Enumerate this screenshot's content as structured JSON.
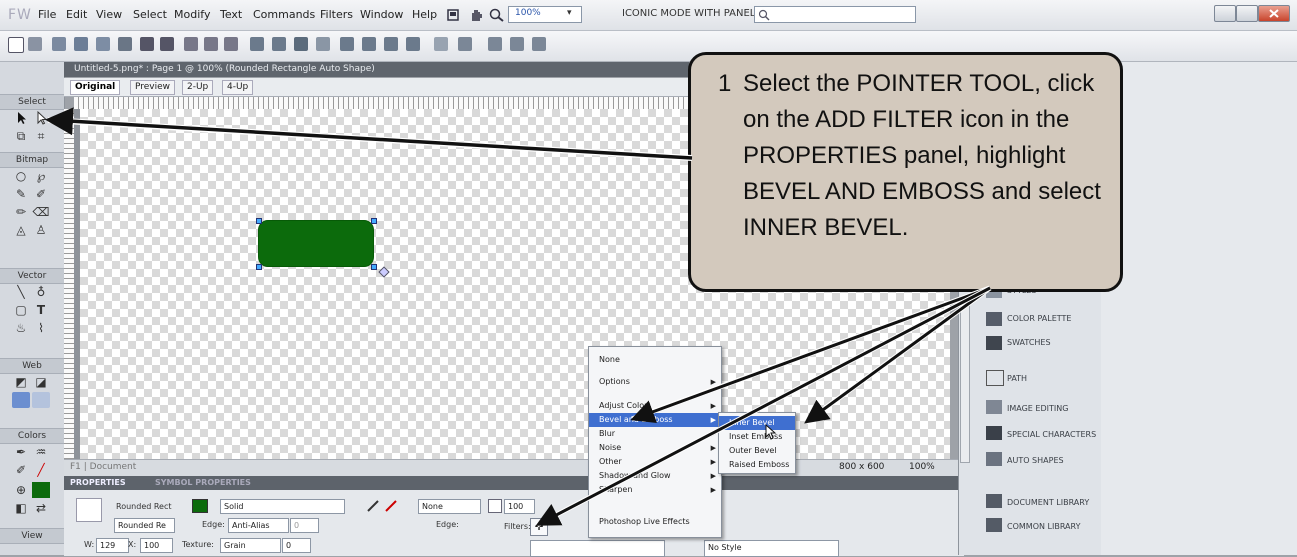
{
  "app": {
    "logo": "FW",
    "menu": [
      "File",
      "Edit",
      "View",
      "Select",
      "Modify",
      "Text",
      "Commands",
      "Filters",
      "Window",
      "Help"
    ],
    "zoom": "100%",
    "workspace_mode": "ICONIC MODE WITH PANEL NAMES",
    "mode_arrow": "▾"
  },
  "document": {
    "title": "Untitled-5.png* : Page 1 @ 100% (Rounded Rectangle Auto Shape)",
    "tabs": [
      "Original",
      "Preview",
      "2-Up",
      "4-Up"
    ],
    "status_size": "800 x 600",
    "status_zoom": "100%",
    "status_left": "F1 | Document"
  },
  "tools": {
    "sections": [
      "Select",
      "Bitmap",
      "Vector",
      "Web",
      "Colors",
      "View"
    ]
  },
  "properties": {
    "tabs": [
      "PROPERTIES",
      "SYMBOL PROPERTIES"
    ],
    "object_type": "Rounded Rect",
    "object_name": "Rounded Re",
    "fill_type": "Solid",
    "edge_label": "Edge:",
    "edge_value": "Anti-Alias",
    "edge_px": "0",
    "texture_label": "Texture:",
    "texture_value": "Grain",
    "texture_pct": "0",
    "stroke_type": "None",
    "stroke_edge_label": "Edge:",
    "opacity": "100",
    "filters_label": "Filters:",
    "add_filter": "+",
    "w_label": "W:",
    "w_value": "129",
    "x_label": "X:",
    "x_value": "100",
    "style_value": "No Style"
  },
  "filter_menu": {
    "items": [
      {
        "label": "None"
      },
      {
        "label": "Options"
      },
      {
        "label": "Adjust Color"
      },
      {
        "label": "Bevel and Emboss"
      },
      {
        "label": "Blur"
      },
      {
        "label": "Noise"
      },
      {
        "label": "Other"
      },
      {
        "label": "Shadow and Glow"
      },
      {
        "label": "Sharpen"
      },
      {
        "label": "Photoshop Live Effects"
      }
    ],
    "submenu": [
      {
        "label": "Inner Bevel"
      },
      {
        "label": "Inset Emboss"
      },
      {
        "label": "Outer Bevel"
      },
      {
        "label": "Raised Emboss"
      }
    ]
  },
  "right_panels": [
    "STYLES",
    "COLOR PALETTE",
    "SWATCHES",
    "PATH",
    "IMAGE EDITING",
    "SPECIAL CHARACTERS",
    "AUTO SHAPES",
    "DOCUMENT LIBRARY",
    "COMMON LIBRARY"
  ],
  "callout": {
    "number": "1",
    "text": "Select the POINTER TOOL, click on the ADD FILTER icon in the PROPERTIES panel, highlight BEVEL AND EMBOSS and select INNER BEVEL."
  },
  "colors": {
    "shape_fill": "#0c6b0c",
    "callout_bg": "#d3c9bd",
    "menu_highlight": "#3f6fd0"
  }
}
